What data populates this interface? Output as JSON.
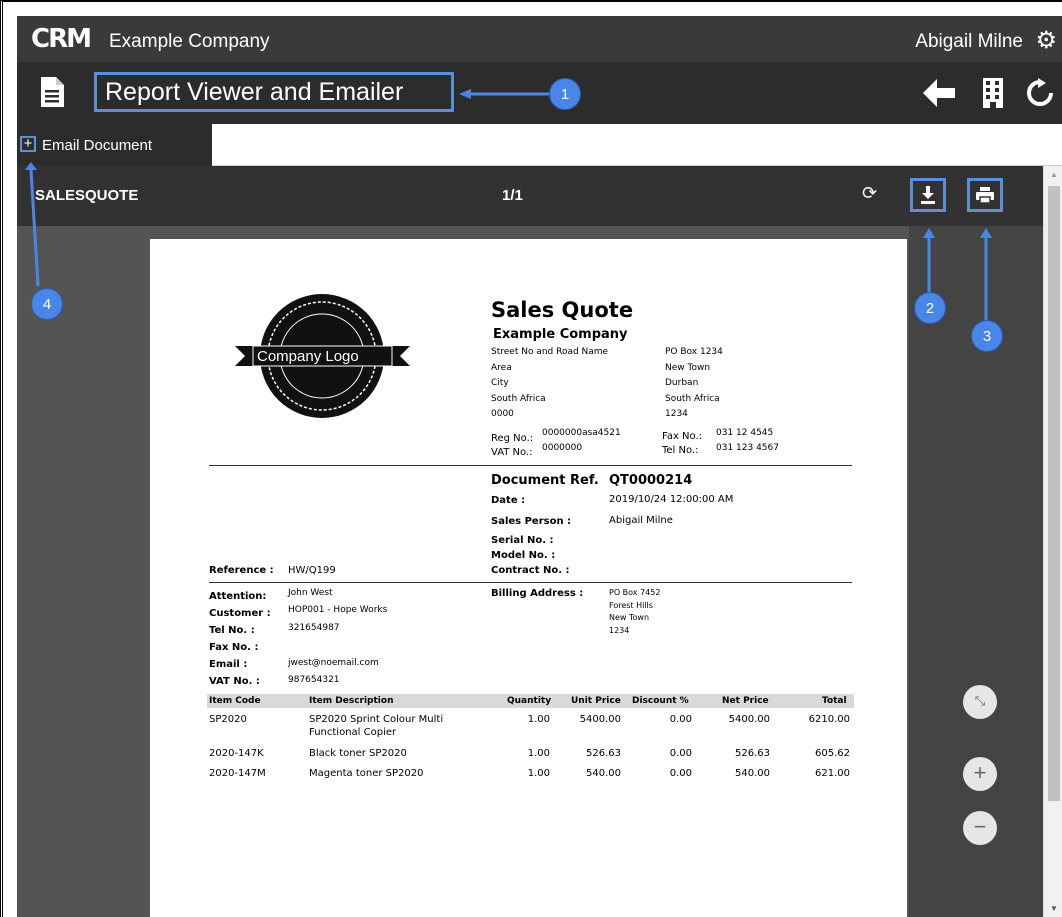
{
  "app": {
    "logo_text": "CRM",
    "company": "Example Company",
    "user": "Abigail Milne"
  },
  "titlebar": {
    "title": "Report Viewer and Emailer"
  },
  "tab": {
    "label": "Email Document"
  },
  "viewer": {
    "report_name": "SALESQUOTE",
    "page_indicator": "1/1"
  },
  "callouts": [
    "1",
    "2",
    "3",
    "4"
  ],
  "document": {
    "logo_text": "Company Logo",
    "heading": "Sales Quote",
    "company_name": "Example Company",
    "address_left": [
      "Street No and Road Name",
      "Area",
      "City",
      "South Africa",
      "0000"
    ],
    "address_right": [
      "PO Box 1234",
      "New Town",
      "Durban",
      "South Africa",
      "1234"
    ],
    "reg_label": "Reg No.:",
    "reg_value": "0000000asa4521",
    "vat_label": "VAT No.:",
    "vat_value": "0000000",
    "fax_label": "Fax No.:",
    "fax_value": "031 12 4545",
    "tel_label": "Tel No.:",
    "tel_value": "031 123 4567",
    "docref_label": "Document Ref.",
    "docref_value": "QT0000214",
    "date_label": "Date :",
    "date_value": "2019/10/24 12:00:00 AM",
    "salesperson_label": "Sales Person :",
    "salesperson_value": "Abigail Milne",
    "serial_label": "Serial No. :",
    "model_label": "Model No. :",
    "contract_label": "Contract No. :",
    "reference_label": "Reference :",
    "reference_value": "HW/Q199",
    "attention_label": "Attention:",
    "attention_value": "John West",
    "customer_label": "Customer :",
    "customer_value": "HOP001 - Hope Works",
    "cust_tel_label": "Tel No. :",
    "cust_tel_value": "321654987",
    "cust_fax_label": "Fax No. :",
    "email_label": "Email :",
    "email_value": "jwest@noemail.com",
    "cust_vat_label": "VAT No. :",
    "cust_vat_value": "987654321",
    "billing_label": "Billing Address :",
    "billing_lines": [
      "PO Box 7452",
      "Forest Hills",
      "New Town",
      "1234"
    ],
    "columns": [
      "Item Code",
      "Item Description",
      "Quantity",
      "Unit Price",
      "Discount %",
      "Net Price",
      "Total"
    ],
    "rows": [
      {
        "code": "SP2020",
        "desc1": "SP2020 Sprint Colour Multi",
        "desc2": "Functional Copier",
        "qty": "1.00",
        "unit": "5400.00",
        "disc": "0.00",
        "net": "5400.00",
        "total": "6210.00"
      },
      {
        "code": "2020-147K",
        "desc1": "Black toner SP2020",
        "desc2": "",
        "qty": "1.00",
        "unit": "526.63",
        "disc": "0.00",
        "net": "526.63",
        "total": "605.62"
      },
      {
        "code": "2020-147M",
        "desc1": "Magenta toner SP2020",
        "desc2": "",
        "qty": "1.00",
        "unit": "540.00",
        "disc": "0.00",
        "net": "540.00",
        "total": "621.00"
      }
    ]
  }
}
